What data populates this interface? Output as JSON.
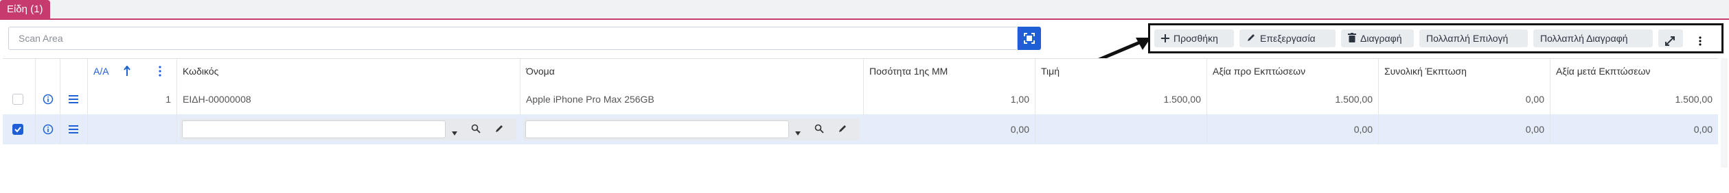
{
  "tab": {
    "label": "Είδη (1)"
  },
  "scan": {
    "placeholder": "Scan Area"
  },
  "toolbar": {
    "add_label": "Προσθήκη",
    "edit_label": "Επεξεργασία",
    "delete_label": "Διαγραφή",
    "multi_select_label": "Πολλαπλή Επιλογή",
    "multi_delete_label": "Πολλαπλή Διαγραφή"
  },
  "columns": {
    "aa": "Α/Α",
    "code": "Κωδικός",
    "name": "Όνομα",
    "qty": "Ποσότητα 1ης ΜΜ",
    "price": "Τιμή",
    "value_before": "Αξία προ Εκπτώσεων",
    "discount": "Συνολική Έκπτωση",
    "value_after": "Αξία μετά Εκπτώσεων"
  },
  "rows": [
    {
      "aa": "1",
      "code": "ΕΙΔΗ-00000008",
      "name": "Apple iPhone Pro Max 256GB",
      "qty": "1,00",
      "price": "1.500,00",
      "value_before": "1.500,00",
      "discount": "0,00",
      "value_after": "1.500,00"
    },
    {
      "qty": "0,00",
      "value_before": "0,00",
      "discount": "0,00",
      "value_after": "0,00"
    }
  ],
  "colors": {
    "tab_accent": "#c63a6e",
    "primary": "#1f5fd6",
    "selected_row": "#e5edfb",
    "highlight_border": "#111111"
  }
}
